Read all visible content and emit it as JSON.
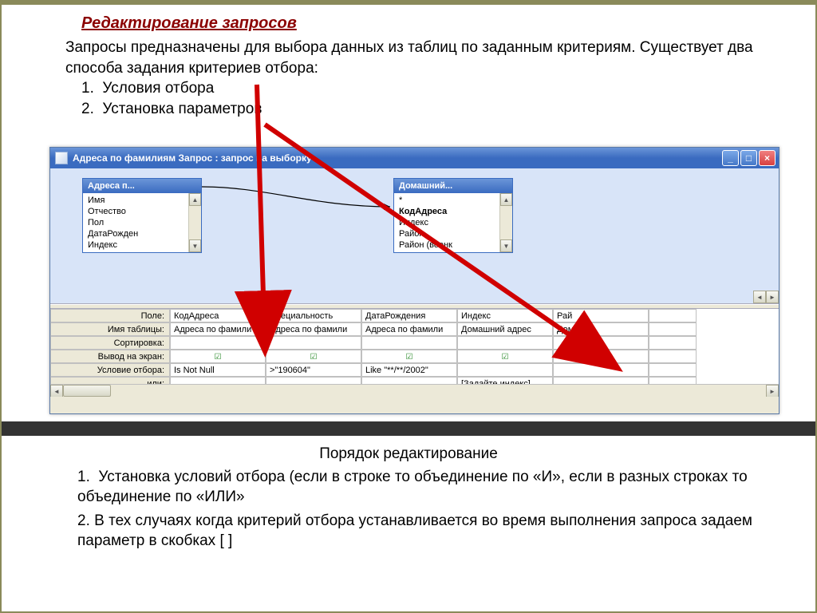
{
  "slide": {
    "title": "Редактирование запросов",
    "intro": "Запросы предназначены для выбора данных из таблиц по заданным критериям. Существует два способа задания критериев отбора:",
    "items": [
      "Условия отбора",
      "Установка параметров"
    ],
    "bottom_heading": "Порядок редактирование",
    "bottom_items": [
      " Установка условий отбора (если в строке то объединение по «И», если в разных строках то объединение по «ИЛИ»",
      "В тех случаях когда критерий отбора устанавливается во время выполнения запроса задаем параметр в скобках [ ]"
    ]
  },
  "window": {
    "title": "Адреса по фамилиям Запрос : запрос на выборку"
  },
  "table1": {
    "title": "Адреса п...",
    "fields": [
      "Имя",
      "Отчество",
      "Пол",
      "ДатаРожден",
      "Индекс"
    ]
  },
  "table2": {
    "title": "Домашний...",
    "fields": [
      "*",
      "КодАдреса",
      "Индекс",
      "Район",
      "Район (военк"
    ]
  },
  "grid": {
    "row_labels": [
      "Поле:",
      "Имя таблицы:",
      "Сортировка:",
      "Вывод на экран:",
      "Условие отбора:",
      "или:"
    ],
    "cols": [
      {
        "field": "КодАдреса",
        "table": "Адреса по фамили",
        "crit": "Is Not Null",
        "or": ""
      },
      {
        "field": "Специальность",
        "table": "Адреса по фамили",
        "crit": ">\"190604\"",
        "or": ""
      },
      {
        "field": "ДатаРождения",
        "table": "Адреса по фамили",
        "crit": "Like \"**/**/2002\"",
        "or": ""
      },
      {
        "field": "Индекс",
        "table": "Домашний адрес",
        "crit": "",
        "or": "[Задайте индекс]"
      },
      {
        "field": "Рай",
        "table": "Дом",
        "crit": "",
        "or": ""
      }
    ],
    "check": "☑"
  }
}
